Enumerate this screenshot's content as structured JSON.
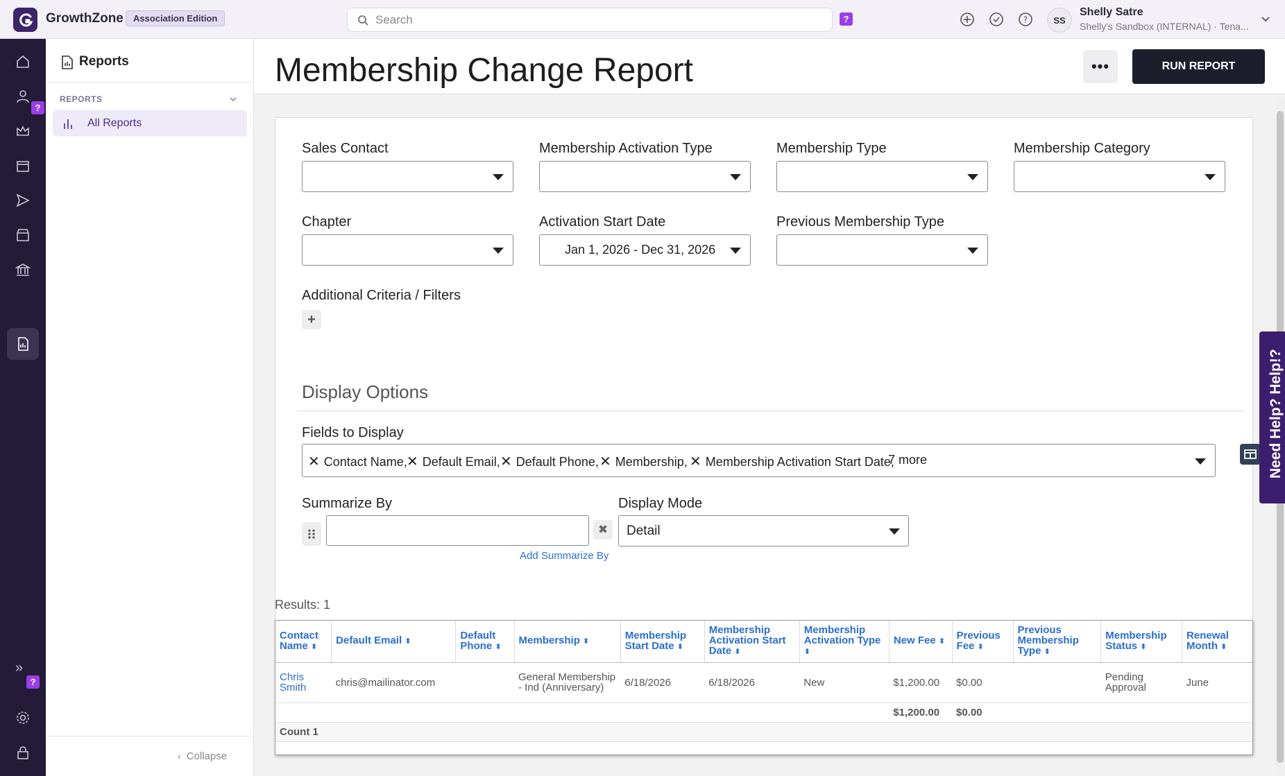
{
  "topbar": {
    "brand": "GrowthZone",
    "edition": "Association Edition",
    "search_placeholder": "Search",
    "help_badge": "?",
    "user_initials": "SS",
    "user_name": "Shelly Satre",
    "user_sub": "Shelly's Sandbox (INTERNAL) · Tena..."
  },
  "rail": {
    "help_badge_1": "?",
    "help_badge_2": "?",
    "expand_glyph": "»"
  },
  "sidebar": {
    "title": "Reports",
    "section": "REPORTS",
    "items": [
      {
        "label": "All Reports"
      }
    ],
    "collapse_label": "Collapse"
  },
  "main": {
    "title": "Membership Change Report",
    "more_label": "•••",
    "run_label": "RUN REPORT"
  },
  "filters": {
    "sales_contact": {
      "label": "Sales Contact",
      "value": ""
    },
    "activation_type": {
      "label": "Membership Activation Type",
      "value": ""
    },
    "membership_type": {
      "label": "Membership Type",
      "value": ""
    },
    "membership_category": {
      "label": "Membership Category",
      "value": ""
    },
    "chapter": {
      "label": "Chapter",
      "value": ""
    },
    "activation_start_date": {
      "label": "Activation Start Date",
      "value": "Jan 1, 2026 - Dec 31, 2026"
    },
    "previous_membership_type": {
      "label": "Previous Membership Type",
      "value": ""
    },
    "additional_criteria": "Additional Criteria / Filters"
  },
  "display": {
    "heading": "Display Options",
    "fields_label": "Fields to Display",
    "fields": [
      "Contact Name,",
      "Default Email,",
      "Default Phone,",
      "Membership,",
      "Membership Activation Start Date,"
    ],
    "more_text": "7 more",
    "summarize_label": "Summarize By",
    "summarize_value": "",
    "add_summarize": "Add Summarize By",
    "mode_label": "Display Mode",
    "mode_value": "Detail"
  },
  "results": {
    "count_text": "Results: 1",
    "columns": [
      "Contact Name",
      "Default Email",
      "Default Phone",
      "Membership",
      "Membership Start Date",
      "Membership Activation Start Date",
      "Membership Activation Type",
      "New Fee",
      "Previous Fee",
      "Previous Membership Type",
      "Membership Status",
      "Renewal Month"
    ],
    "rows": [
      [
        "Chris Smith",
        "chris@mailinator.com",
        "",
        "General Membership - Ind (Anniversary)",
        "6/18/2026",
        "6/18/2026",
        "New",
        "$1,200.00",
        "$0.00",
        "",
        "Pending Approval",
        "June"
      ]
    ],
    "totals": {
      "new_fee": "$1,200.00",
      "previous_fee": "$0.00"
    },
    "count_label": "Count 1"
  },
  "help_tab": "Need Help? Help!?",
  "colors": {
    "accent": "#3b2469",
    "link": "#2a6fd0",
    "run_button": "#1c1f2b",
    "badge": "#9b3ee8"
  }
}
